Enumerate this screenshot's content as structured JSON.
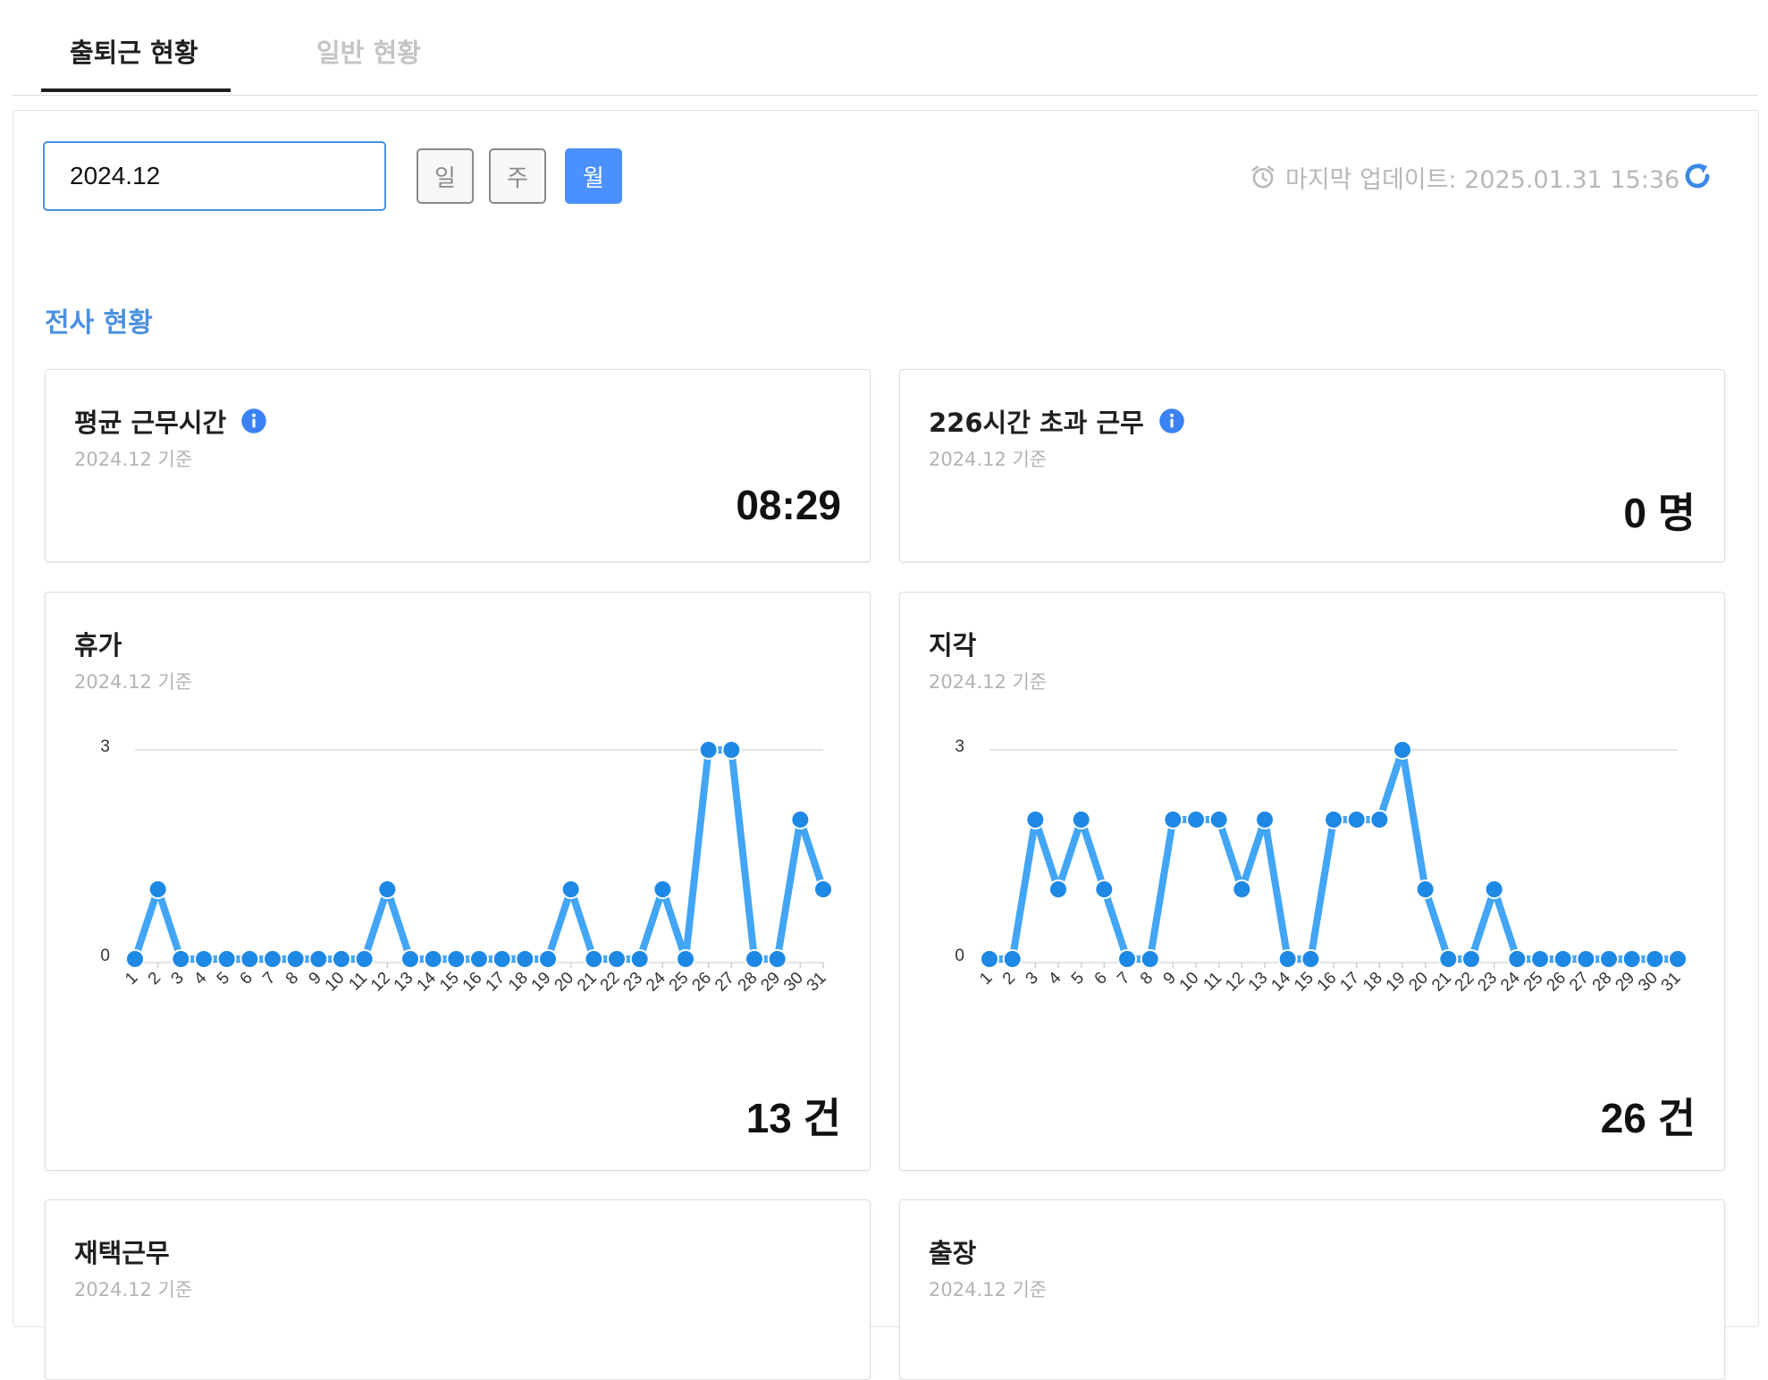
{
  "tabs": [
    {
      "label": "출퇴근 현황",
      "active": true
    },
    {
      "label": "일반 현황",
      "active": false
    }
  ],
  "filter": {
    "date_value": "2024.12",
    "period_buttons": [
      "일",
      "주",
      "월"
    ],
    "active_period": "월"
  },
  "last_update": {
    "icon": "alarm-clock-icon",
    "label": "마지막 업데이트: 2025.01.31 15:36"
  },
  "refresh_icon": "refresh-icon",
  "section_title": "전사 현황",
  "colors": {
    "accent": "#4a90e2",
    "button_active": "#4a90ff",
    "chart_line": "#42a5f5",
    "chart_point": "#1e88e5"
  },
  "cards": {
    "avg_work": {
      "title": "평균 근무시간",
      "subtitle": "2024.12 기준",
      "value": "08:29",
      "icon": "info-icon"
    },
    "overtime": {
      "title": "226시간 초과 근무",
      "subtitle": "2024.12 기준",
      "value": "0 명",
      "icon": "info-icon"
    },
    "vacation": {
      "title": "휴가",
      "subtitle": "2024.12 기준",
      "value": "13 건"
    },
    "late": {
      "title": "지각",
      "subtitle": "2024.12 기준",
      "value": "26 건"
    },
    "remote": {
      "title": "재택근무",
      "subtitle": "2024.12 기준"
    },
    "trip": {
      "title": "출장",
      "subtitle": "2024.12 기준"
    }
  },
  "chart_data": [
    {
      "type": "line",
      "x": [
        "1",
        "2",
        "3",
        "4",
        "5",
        "6",
        "7",
        "8",
        "9",
        "10",
        "11",
        "12",
        "13",
        "14",
        "15",
        "16",
        "17",
        "18",
        "19",
        "20",
        "21",
        "22",
        "23",
        "24",
        "25",
        "26",
        "27",
        "28",
        "29",
        "30",
        "31"
      ],
      "values": [
        0,
        1,
        0,
        0,
        0,
        0,
        0,
        0,
        0,
        0,
        0,
        1,
        0,
        0,
        0,
        0,
        0,
        0,
        0,
        1,
        0,
        0,
        0,
        1,
        0,
        3,
        3,
        0,
        0,
        2,
        1
      ],
      "yticks": [
        0,
        3
      ],
      "ylim": [
        0,
        3
      ]
    },
    {
      "type": "line",
      "x": [
        "1",
        "2",
        "3",
        "4",
        "5",
        "6",
        "7",
        "8",
        "9",
        "10",
        "11",
        "12",
        "13",
        "14",
        "15",
        "16",
        "17",
        "18",
        "19",
        "20",
        "21",
        "22",
        "23",
        "24",
        "25",
        "26",
        "27",
        "28",
        "29",
        "30",
        "31"
      ],
      "values": [
        0,
        0,
        2,
        1,
        2,
        1,
        0,
        0,
        2,
        2,
        2,
        1,
        2,
        0,
        0,
        2,
        2,
        2,
        3,
        1,
        0,
        0,
        1,
        0,
        0,
        0,
        0,
        0,
        0,
        0,
        0
      ],
      "yticks": [
        0,
        3
      ],
      "ylim": [
        0,
        3
      ]
    }
  ]
}
